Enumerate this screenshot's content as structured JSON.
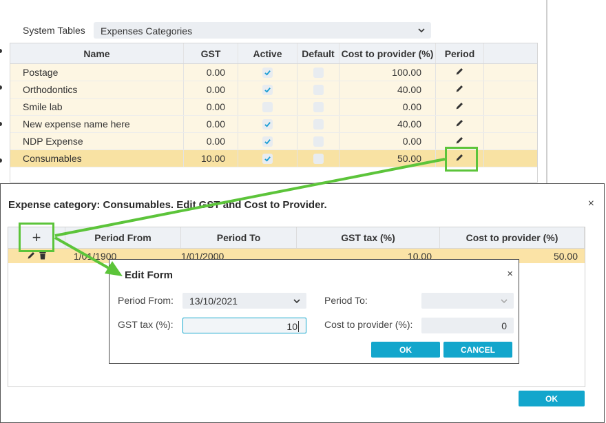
{
  "system_tables": {
    "label": "System Tables",
    "selected": "Expenses Categories"
  },
  "expense_table": {
    "columns": [
      "Name",
      "GST",
      "Active",
      "Default",
      "Cost to provider (%)",
      "Period"
    ],
    "rows": [
      {
        "name": "Postage",
        "gst": "0.00",
        "active": true,
        "default": false,
        "cost": "100.00"
      },
      {
        "name": "Orthodontics",
        "gst": "0.00",
        "active": true,
        "default": false,
        "cost": "40.00"
      },
      {
        "name": "Smile lab",
        "gst": "0.00",
        "active": false,
        "default": false,
        "cost": "0.00"
      },
      {
        "name": "New expense name here",
        "gst": "0.00",
        "active": true,
        "default": false,
        "cost": "40.00"
      },
      {
        "name": "NDP Expense",
        "gst": "0.00",
        "active": true,
        "default": false,
        "cost": "0.00"
      },
      {
        "name": "Consumables",
        "gst": "10.00",
        "active": true,
        "default": false,
        "cost": "50.00"
      }
    ]
  },
  "category_dialog": {
    "title": "Expense category: Consumables. Edit GST and Cost to Provider.",
    "add_icon": "+",
    "columns": [
      "Period From",
      "Period To",
      "GST tax (%)",
      "Cost to provider (%)"
    ],
    "row": {
      "period_from": "1/01/1900",
      "period_to": "1/01/2000",
      "gst": "10.00",
      "cost": "50.00"
    },
    "ok_label": "OK"
  },
  "edit_form": {
    "title": "Edit Form",
    "period_from_label": "Period From:",
    "period_from_value": "13/10/2021",
    "period_to_label": "Period To:",
    "period_to_value": "",
    "gst_label": "GST tax (%):",
    "gst_value": "10",
    "cost_label": "Cost to provider (%):",
    "cost_value": "0",
    "ok_label": "OK",
    "cancel_label": "CANCEL"
  },
  "colors": {
    "accent": "#13a6cc",
    "row_bg": "#fdf6e3",
    "selected_row_bg": "#f8e2a3",
    "annotation_green": "#5cc43a",
    "check": "#1a9ed4"
  },
  "icons": {
    "close": "×",
    "dropdown": "chevron-down-icon",
    "edit": "pencil-icon",
    "delete": "trash-icon"
  }
}
